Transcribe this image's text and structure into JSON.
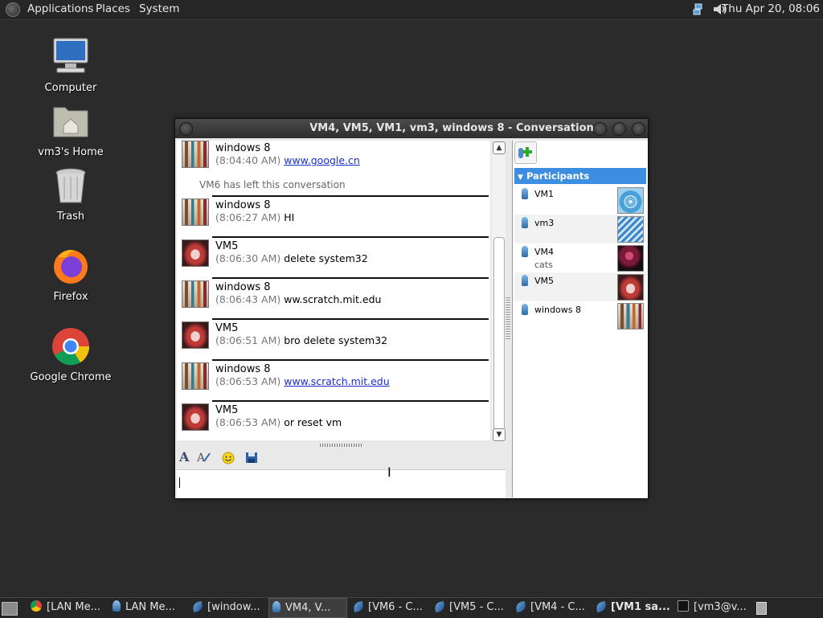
{
  "top_panel": {
    "menus": [
      "Applications",
      "Places",
      "System"
    ],
    "clock": "Thu Apr 20, 08:06"
  },
  "desktop_icons": [
    {
      "label": "Computer",
      "icon": "computer-icon"
    },
    {
      "label": "vm3's Home",
      "icon": "home-folder-icon"
    },
    {
      "label": "Trash",
      "icon": "trash-icon"
    },
    {
      "label": "Firefox",
      "icon": "firefox-icon"
    },
    {
      "label": "Google Chrome",
      "icon": "chrome-icon"
    }
  ],
  "window": {
    "title": "VM4, VM5, VM1, vm3, windows 8 - Conversation",
    "messages": [
      {
        "name": "windows 8",
        "time": "(8:04:40 AM)",
        "text": "www.google.cn",
        "link": true,
        "avatar": "windows8"
      },
      {
        "name": "windows 8",
        "time": "(8:06:27 AM)",
        "text": "HI",
        "link": false,
        "avatar": "windows8"
      },
      {
        "name": "VM5",
        "time": "(8:06:30 AM)",
        "text": "delete system32",
        "link": false,
        "avatar": "vm5"
      },
      {
        "name": "windows 8",
        "time": "(8:06:43 AM)",
        "text": "ww.scratch.mit.edu",
        "link": false,
        "avatar": "windows8"
      },
      {
        "name": "VM5",
        "time": "(8:06:51 AM)",
        "text": "bro delete system32",
        "link": false,
        "avatar": "vm5"
      },
      {
        "name": "windows 8",
        "time": "(8:06:53 AM)",
        "text": "www.scratch.mit.edu",
        "link": true,
        "avatar": "windows8"
      },
      {
        "name": "VM5",
        "time": "(8:06:53 AM)",
        "text": "or reset vm",
        "link": false,
        "avatar": "vm5"
      }
    ],
    "system_message": "VM6 has left this conversation",
    "input_value": "",
    "participants_header": "Participants",
    "participants": [
      {
        "name": "VM1",
        "status": "",
        "avatar": "ferris-wheel"
      },
      {
        "name": "vm3",
        "status": "",
        "avatar": "ferris-wheel-2"
      },
      {
        "name": "VM4",
        "status": "cats",
        "avatar": "ball"
      },
      {
        "name": "VM5",
        "status": "",
        "avatar": "origami"
      },
      {
        "name": "windows 8",
        "status": "",
        "avatar": "crayons"
      }
    ]
  },
  "taskbar": {
    "tasks": [
      {
        "label": "[LAN Me...",
        "icon": "chrome-icon",
        "active": false,
        "bold": false
      },
      {
        "label": "LAN Me...",
        "icon": "buddy-icon",
        "active": false,
        "bold": false
      },
      {
        "label": "[window...",
        "icon": "feather-icon",
        "active": false,
        "bold": false
      },
      {
        "label": "VM4, V...",
        "icon": "buddy-icon",
        "active": true,
        "bold": false
      },
      {
        "label": "[VM6 - C...",
        "icon": "feather-icon",
        "active": false,
        "bold": false
      },
      {
        "label": "[VM5 - C...",
        "icon": "feather-icon",
        "active": false,
        "bold": false
      },
      {
        "label": "[VM4 - C...",
        "icon": "feather-icon",
        "active": false,
        "bold": false
      },
      {
        "label": "[VM1 sa...",
        "icon": "feather-icon",
        "active": false,
        "bold": true
      },
      {
        "label": "[vm3@v...",
        "icon": "terminal-icon",
        "active": false,
        "bold": false
      }
    ]
  }
}
